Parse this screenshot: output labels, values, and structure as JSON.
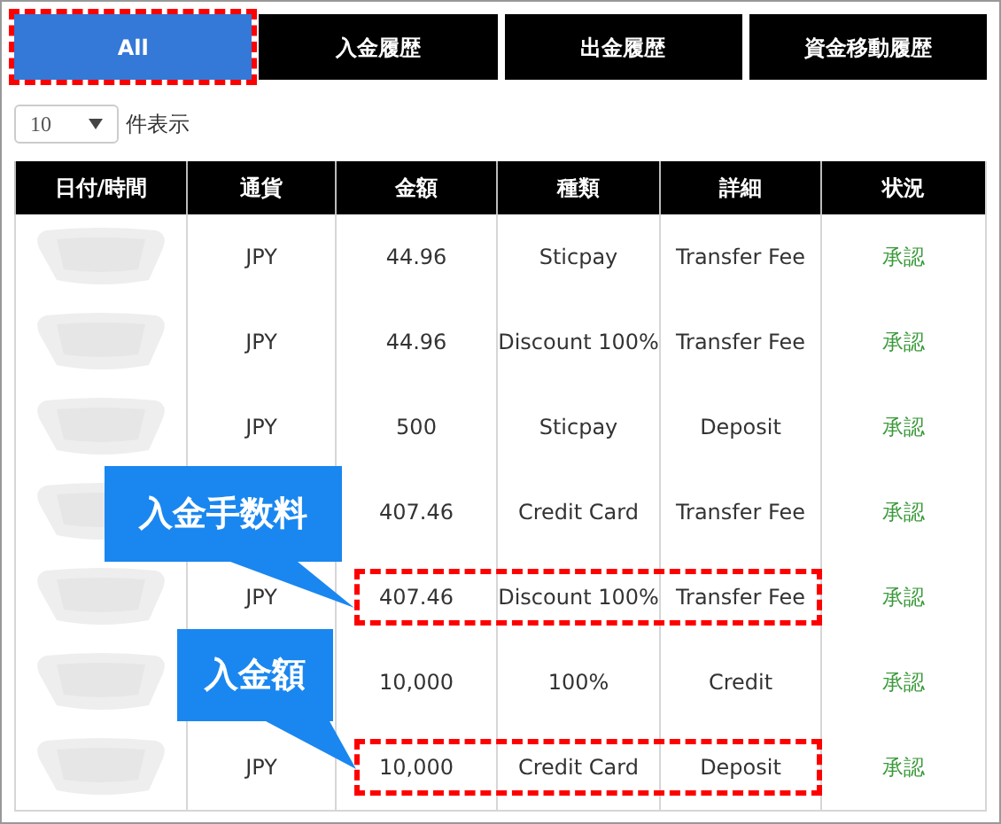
{
  "tabs": [
    {
      "label": "All",
      "selected": true,
      "highlighted": true
    },
    {
      "label": "入金履歴",
      "selected": false,
      "highlighted": false
    },
    {
      "label": "出金履歴",
      "selected": false,
      "highlighted": false
    },
    {
      "label": "資金移動履歴",
      "selected": false,
      "highlighted": false
    }
  ],
  "page_size": {
    "value": "10",
    "label": "件表示"
  },
  "table": {
    "columns": [
      "日付/時間",
      "通貨",
      "金額",
      "種類",
      "詳細",
      "状況"
    ],
    "rows": [
      {
        "currency": "JPY",
        "amount": "44.96",
        "type": "Sticpay",
        "detail": "Transfer Fee",
        "status": "承認",
        "highlighted": false
      },
      {
        "currency": "JPY",
        "amount": "44.96",
        "type": "Discount 100%",
        "detail": "Transfer Fee",
        "status": "承認",
        "highlighted": false
      },
      {
        "currency": "JPY",
        "amount": "500",
        "type": "Sticpay",
        "detail": "Deposit",
        "status": "承認",
        "highlighted": false
      },
      {
        "amount": "407.46",
        "type": "Credit Card",
        "detail": "Transfer Fee",
        "status": "承認",
        "highlighted": false
      },
      {
        "currency": "JPY",
        "amount": "407.46",
        "type": "Discount 100%",
        "detail": "Transfer Fee",
        "status": "承認",
        "highlighted": true,
        "callout": {
          "text": "入金手数料",
          "kind": "wide"
        }
      },
      {
        "amount": "10,000",
        "type": "100%",
        "detail": "Credit",
        "status": "承認",
        "highlighted": false
      },
      {
        "currency": "JPY",
        "amount": "10,000",
        "type": "Credit Card",
        "detail": "Deposit",
        "status": "承認",
        "highlighted": true,
        "callout": {
          "text": "入金額",
          "kind": "narrow"
        }
      }
    ]
  }
}
